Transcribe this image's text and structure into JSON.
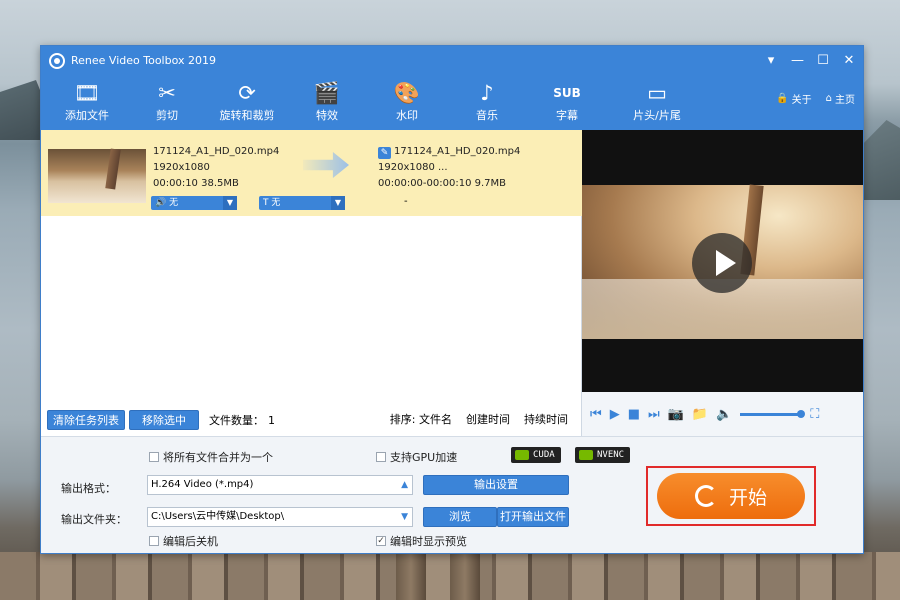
{
  "window": {
    "title": "Renee Video Toolbox 2019",
    "controls": [
      "▾",
      "—",
      "☐",
      "✕"
    ]
  },
  "toolbar": {
    "items": [
      {
        "label": "添加文件",
        "icon": "add-file-icon",
        "glyph": "🎞"
      },
      {
        "label": "剪切",
        "icon": "scissors-icon",
        "glyph": "✂"
      },
      {
        "label": "旋转和裁剪",
        "icon": "rotate-crop-icon",
        "glyph": "⟳"
      },
      {
        "label": "特效",
        "icon": "effects-icon",
        "glyph": "🎬"
      },
      {
        "label": "水印",
        "icon": "watermark-icon",
        "glyph": "🎨"
      },
      {
        "label": "音乐",
        "icon": "music-icon",
        "glyph": "♪"
      },
      {
        "label": "字幕",
        "icon": "subtitle-icon",
        "glyph": "SUB"
      },
      {
        "label": "片头/片尾",
        "icon": "intro-outro-icon",
        "glyph": "▭"
      }
    ],
    "about": "关于",
    "home": "主页"
  },
  "file": {
    "source": {
      "name": "171124_A1_HD_020.mp4",
      "resolution": "1920x1080",
      "duration_size": "00:00:10 38.5MB"
    },
    "output": {
      "name": "171124_A1_HD_020.mp4",
      "resolution": "1920x1080    ...",
      "duration_size": "00:00:00-00:00:10 9.7MB"
    },
    "audio_select": "无",
    "subtitle_select": "无",
    "dash": "-"
  },
  "list_footer": {
    "clear_label": "清除任务列表",
    "remove_label": "移除选中",
    "count_label": "文件数量：",
    "count": "1",
    "sort_label": "排序:",
    "sort_filename": "文件名",
    "sort_created": "创建时间",
    "sort_duration": "持续时间"
  },
  "options": {
    "merge_label": "将所有文件合并为一个",
    "merge_checked": false,
    "gpu_label": "支持GPU加速",
    "gpu_checked": false,
    "cuda": "CUDA",
    "nvenc": "NVENC",
    "shutdown_label": "编辑后关机",
    "shutdown_checked": false,
    "preview_label": "编辑时显示预览",
    "preview_checked": true
  },
  "output": {
    "format_label": "输出格式：",
    "format_value": "H.264 Video (*.mp4)",
    "settings_label": "输出设置",
    "folder_label": "输出文件夹：",
    "folder_value": "C:\\Users\\云中传媒\\Desktop\\",
    "browse_label": "浏览",
    "open_label": "打开输出文件"
  },
  "start": {
    "label": "开始",
    "color": "#F07A17"
  },
  "colors": {
    "accent": "#3B84D8",
    "row_highlight": "#FBEEB6",
    "highlight_box": "#E12A2A"
  }
}
